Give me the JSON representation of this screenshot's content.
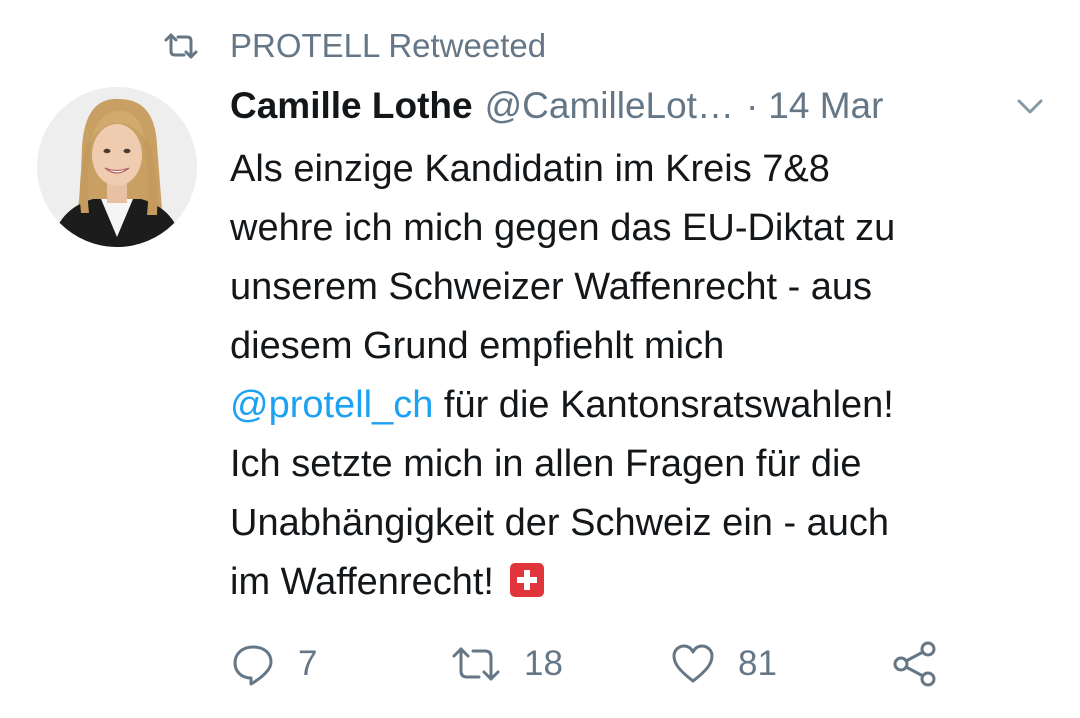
{
  "retweet_banner": {
    "icon": "retweet-icon",
    "text": "PROTELL Retweeted"
  },
  "tweet": {
    "author": {
      "display_name": "Camille Lothe",
      "handle": "@CamilleLot…",
      "avatar": "avatar-photo"
    },
    "separator": "·",
    "date": "14 Mar",
    "menu_icon": "chevron-down-icon",
    "body_lines": [
      "Als einzige Kandidatin im Kreis 7&8",
      "wehre ich mich gegen das EU-Diktat zu",
      "unserem Schweizer Waffenrecht - aus",
      "diesem Grund empfiehlt mich"
    ],
    "mention": "@protell_ch",
    "mention_rest": " für die Kantonsratswahlen!",
    "body_lines_after": [
      "Ich setzte mich in allen Fragen für die",
      "Unabhängigkeit der Schweiz ein - auch"
    ],
    "last_line": "im Waffenrecht!",
    "emoji": "swiss-flag-emoji"
  },
  "actions": {
    "reply": {
      "icon": "reply-icon",
      "count": "7"
    },
    "retweet": {
      "icon": "retweet-icon",
      "count": "18"
    },
    "like": {
      "icon": "heart-icon",
      "count": "81"
    },
    "share": {
      "icon": "share-icon"
    }
  },
  "colors": {
    "text": "#14171a",
    "secondary": "#657786",
    "link": "#1da1f2",
    "flag_red": "#e0353b"
  }
}
